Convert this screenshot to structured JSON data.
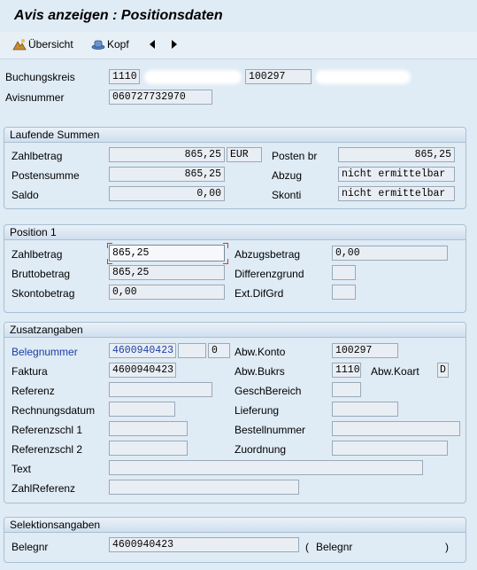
{
  "window": {
    "title": "Avis anzeigen : Positionsdaten"
  },
  "toolbar": {
    "overview_label": "Übersicht",
    "header_label": "Kopf"
  },
  "header": {
    "buchungskreis_label": "Buchungskreis",
    "buchungskreis_value": "1110",
    "partner_value": "100297",
    "avisnummer_label": "Avisnummer",
    "avisnummer_value": "060727732970"
  },
  "laufende_summen": {
    "title": "Laufende Summen",
    "zahlbetrag_label": "Zahlbetrag",
    "zahlbetrag_value": "865,25",
    "currency": "EUR",
    "posten_br_label": "Posten br",
    "posten_br_value": "865,25",
    "postensumme_label": "Postensumme",
    "postensumme_value": "865,25",
    "abzug_label": "Abzug",
    "abzug_value": "nicht ermittelbar",
    "saldo_label": "Saldo",
    "saldo_value": "0,00",
    "skonti_label": "Skonti",
    "skonti_value": "nicht ermittelbar"
  },
  "position": {
    "title": "Position 1",
    "zahlbetrag_label": "Zahlbetrag",
    "zahlbetrag_value": "865,25",
    "abzugsbetrag_label": "Abzugsbetrag",
    "abzugsbetrag_value": "0,00",
    "bruttobetrag_label": "Bruttobetrag",
    "bruttobetrag_value": "865,25",
    "differenzgrund_label": "Differenzgrund",
    "differenzgrund_value": "",
    "skontobetrag_label": "Skontobetrag",
    "skontobetrag_value": "0,00",
    "ext_difgrd_label": "Ext.DifGrd",
    "ext_difgrd_value": ""
  },
  "zusatz": {
    "title": "Zusatzangaben",
    "belegnummer_label": "Belegnummer",
    "belegnummer_value": "4600940423",
    "belegnummer_extra": "",
    "belegnummer_index": "0",
    "abw_konto_label": "Abw.Konto",
    "abw_konto_value": "100297",
    "faktura_label": "Faktura",
    "faktura_value": "4600940423",
    "abw_bukrs_label": "Abw.Bukrs",
    "abw_bukrs_value": "1110",
    "abw_koart_label": "Abw.Koart",
    "abw_koart_value": "D",
    "referenz_label": "Referenz",
    "geschbereich_label": "GeschBereich",
    "rechnungsdatum_label": "Rechnungsdatum",
    "lieferung_label": "Lieferung",
    "referenzschl1_label": "Referenzschl 1",
    "bestellnummer_label": "Bestellnummer",
    "referenzschl2_label": "Referenzschl 2",
    "zuordnung_label": "Zuordnung",
    "text_label": "Text",
    "zahlreferenz_label": "ZahlReferenz"
  },
  "selektion": {
    "title": "Selektionsangaben",
    "belegnr_label": "Belegnr",
    "belegnr_value": "4600940423",
    "paren_open": "(",
    "belegnr_label2": "Belegnr",
    "paren_close": ")"
  },
  "colors": {
    "background": "#dfebf5",
    "link_blue": "#1a3ea6",
    "focus_red": "#e03030"
  },
  "icons": [
    "overview-icon",
    "header-hat-icon",
    "previous-arrow-icon",
    "next-arrow-icon"
  ]
}
